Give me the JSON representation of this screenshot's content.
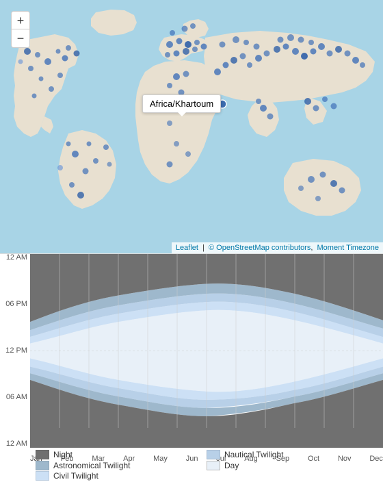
{
  "map": {
    "zoom_in_label": "+",
    "zoom_out_label": "−",
    "tooltip_text": "Africa/Khartoum",
    "attribution_leaflet": "Leaflet",
    "attribution_osm": "© OpenStreetMap contributors",
    "attribution_moment": "Moment Timezone"
  },
  "chart": {
    "y_labels": [
      "12 AM",
      "06 PM",
      "12 PM",
      "06 AM",
      "12 AM"
    ],
    "x_labels": [
      "Jan",
      "Feb",
      "Mar",
      "Apr",
      "May",
      "Jun",
      "Jul",
      "Aug",
      "Sep",
      "Oct",
      "Nov",
      "Dec"
    ],
    "legend": [
      {
        "id": "night",
        "label": "Night",
        "color": "#7a7a7a"
      },
      {
        "id": "nautical",
        "label": "Nautical Twilight",
        "color": "#b8cfe8"
      },
      {
        "id": "day",
        "label": "Day",
        "color": "#e8f0f8"
      },
      {
        "id": "astronomical",
        "label": "Astronomical Twilight",
        "color": "#9eafc2"
      },
      {
        "id": "civil",
        "label": "Civil Twilight",
        "color": "#d0dff0"
      }
    ]
  }
}
